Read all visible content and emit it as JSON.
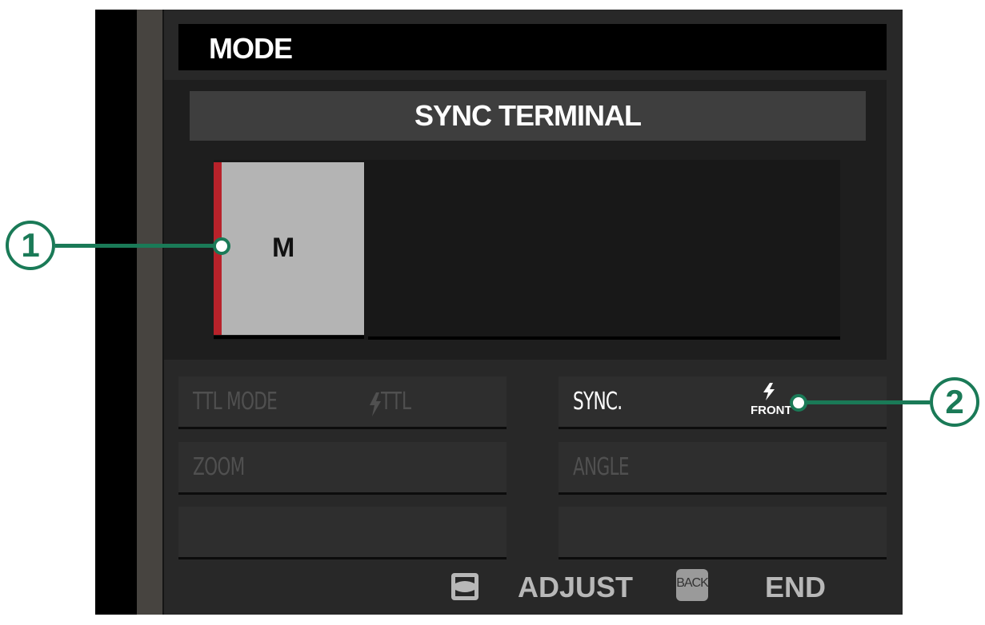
{
  "title": "MODE",
  "section_header": "SYNC TERMINAL",
  "mode_options": [
    {
      "label": "M",
      "selected": true
    }
  ],
  "settings": {
    "ttl_mode": {
      "label": "TTL MODE",
      "value": "TTL"
    },
    "sync": {
      "label": "SYNC.",
      "value": "FRONT"
    },
    "zoom": {
      "label": "ZOOM"
    },
    "angle": {
      "label": "ANGLE"
    }
  },
  "footer": {
    "adjust_label": "ADJUST",
    "back_icon_text": "BACK",
    "end_label": "END"
  },
  "callouts": [
    "1",
    "2"
  ],
  "colors": {
    "accent": "#b8222a",
    "callout": "#1a7a57"
  }
}
